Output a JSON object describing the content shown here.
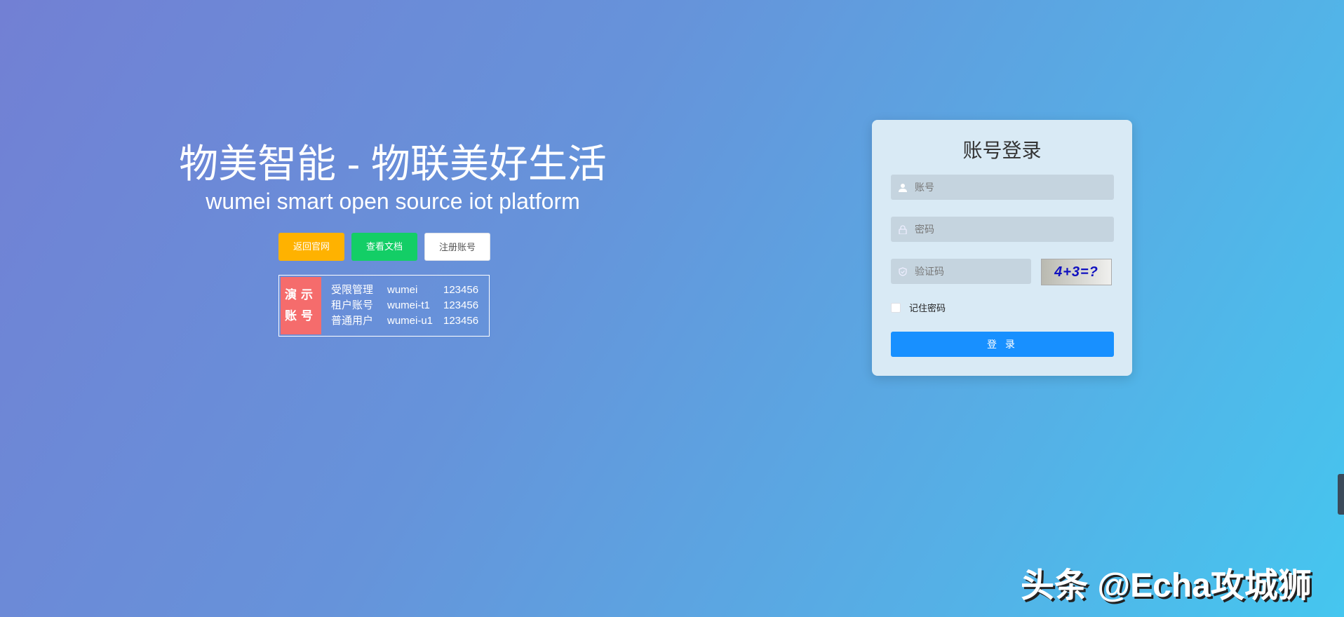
{
  "hero": {
    "title": "物美智能 - 物联美好生活",
    "subtitle": "wumei smart open source iot platform"
  },
  "buttons": {
    "official": "返回官网",
    "docs": "查看文档",
    "register": "注册账号"
  },
  "demo": {
    "tag_line1": "演示",
    "tag_line2": "账号",
    "rows": [
      {
        "role": "受限管理",
        "user": "wumei",
        "pass": "123456"
      },
      {
        "role": "租户账号",
        "user": "wumei-t1",
        "pass": "123456"
      },
      {
        "role": "普通用户",
        "user": "wumei-u1",
        "pass": "123456"
      }
    ]
  },
  "login": {
    "title": "账号登录",
    "username_placeholder": "账号",
    "password_placeholder": "密码",
    "code_placeholder": "验证码",
    "captcha": "4+3=?",
    "remember": "记住密码",
    "submit": "登 录"
  },
  "watermark": "头条 @Echa攻城狮"
}
